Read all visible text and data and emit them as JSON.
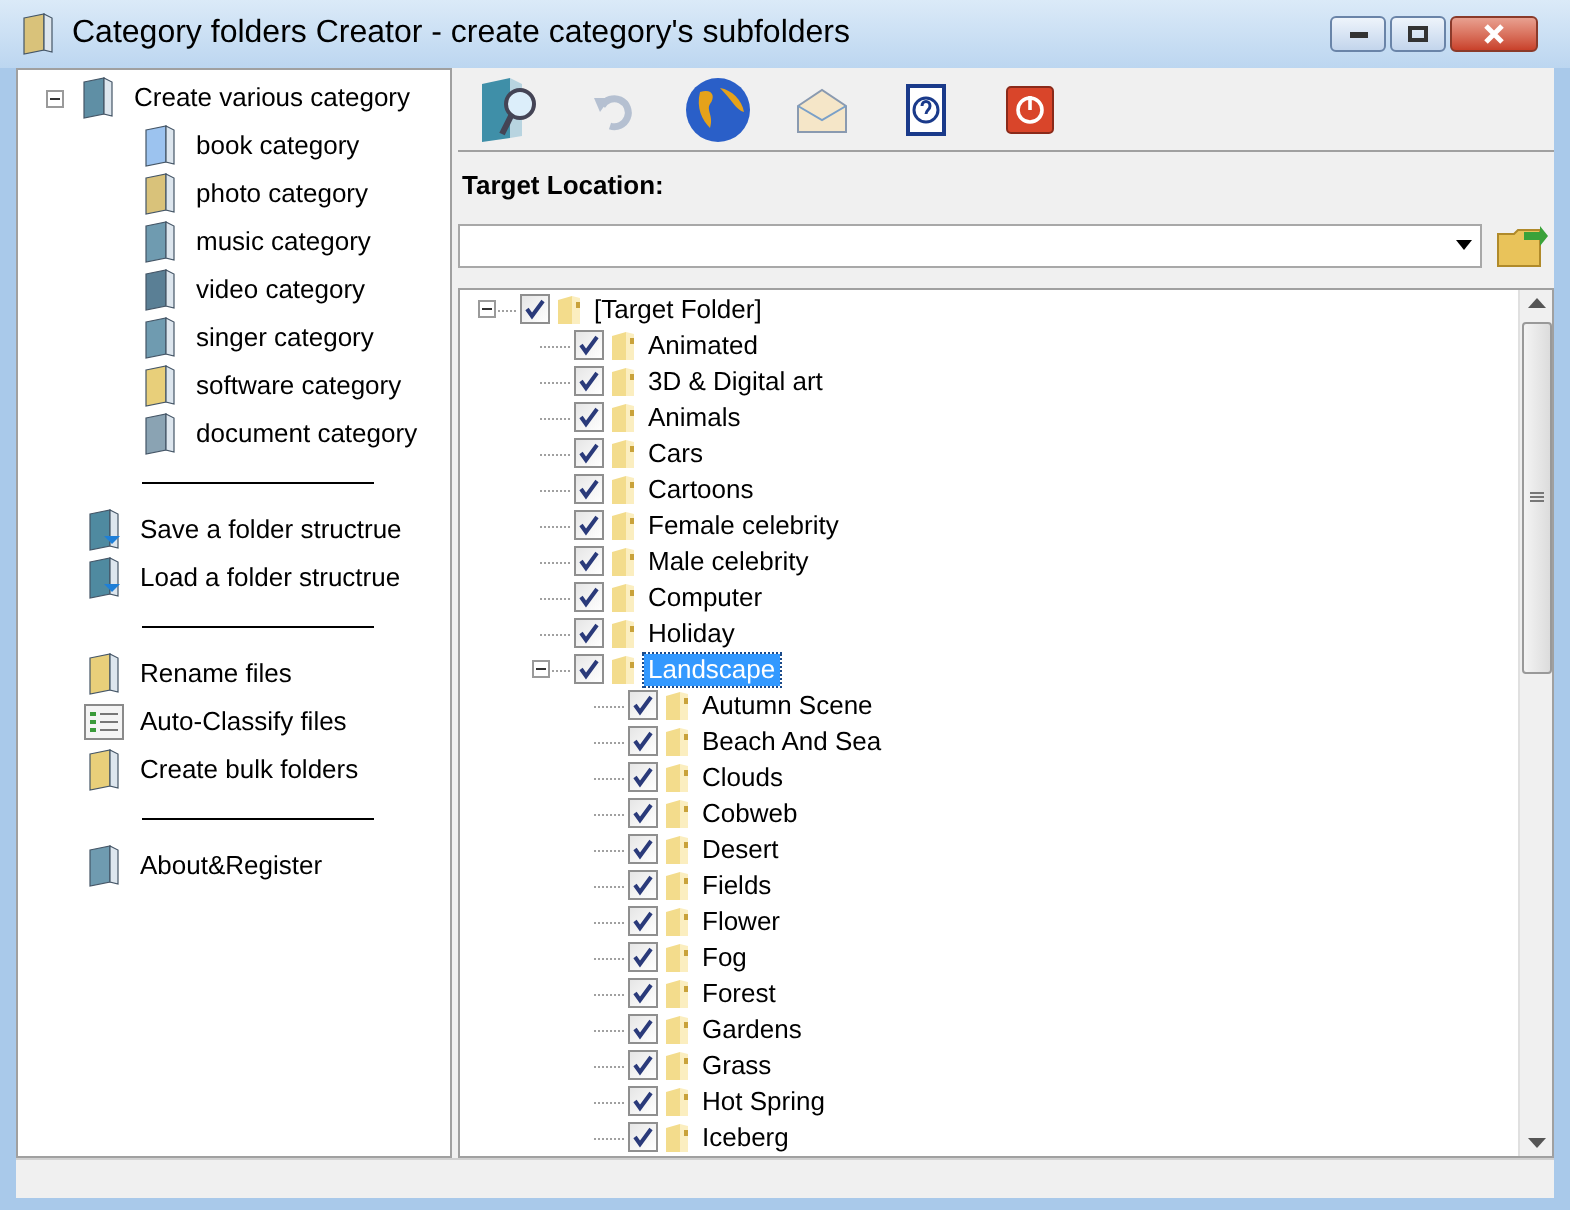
{
  "window": {
    "title": "Category folders Creator -  create category's subfolders"
  },
  "sidebar": {
    "items": [
      {
        "kind": "node",
        "label": "Create various category",
        "expanded": true,
        "children": [
          {
            "kind": "book",
            "label": "book category"
          },
          {
            "kind": "photo",
            "label": "photo category"
          },
          {
            "kind": "music",
            "label": "music category"
          },
          {
            "kind": "video",
            "label": "video category"
          },
          {
            "kind": "singer",
            "label": "singer category"
          },
          {
            "kind": "folder",
            "label": "software category"
          },
          {
            "kind": "document",
            "label": "document category"
          }
        ]
      },
      {
        "kind": "separator"
      },
      {
        "kind": "save",
        "label": "Save a folder structrue"
      },
      {
        "kind": "load",
        "label": "Load a folder structrue"
      },
      {
        "kind": "separator"
      },
      {
        "kind": "folder",
        "label": "Rename files"
      },
      {
        "kind": "list",
        "label": "Auto-Classify files"
      },
      {
        "kind": "folder",
        "label": "Create bulk folders"
      },
      {
        "kind": "separator"
      },
      {
        "kind": "about",
        "label": "About&Register"
      }
    ]
  },
  "toolbar": [
    {
      "kind": "browse",
      "disabled": false
    },
    {
      "kind": "undo",
      "disabled": true
    },
    {
      "kind": "web",
      "disabled": false
    },
    {
      "kind": "mail",
      "disabled": false
    },
    {
      "kind": "help",
      "disabled": false
    },
    {
      "kind": "exit",
      "disabled": false
    }
  ],
  "target_location": {
    "label": "Target Location:"
  },
  "tree": {
    "root": {
      "label": "[Target Folder]",
      "checked": true,
      "expanded": true,
      "selected": false,
      "children": [
        {
          "label": "Animated",
          "checked": true,
          "selected": false
        },
        {
          "label": "3D & Digital art",
          "checked": true,
          "selected": false
        },
        {
          "label": "Animals",
          "checked": true,
          "selected": false
        },
        {
          "label": "Cars",
          "checked": true,
          "selected": false
        },
        {
          "label": "Cartoons",
          "checked": true,
          "selected": false
        },
        {
          "label": "Female celebrity",
          "checked": true,
          "selected": false
        },
        {
          "label": "Male celebrity",
          "checked": true,
          "selected": false
        },
        {
          "label": "Computer",
          "checked": true,
          "selected": false
        },
        {
          "label": "Holiday",
          "checked": true,
          "selected": false
        },
        {
          "label": "Landscape",
          "checked": true,
          "selected": true,
          "expanded": true,
          "children": [
            {
              "label": "Autumn Scene",
              "checked": true,
              "selected": false
            },
            {
              "label": "Beach And Sea",
              "checked": true,
              "selected": false
            },
            {
              "label": "Clouds",
              "checked": true,
              "selected": false
            },
            {
              "label": "Cobweb",
              "checked": true,
              "selected": false
            },
            {
              "label": "Desert",
              "checked": true,
              "selected": false
            },
            {
              "label": "Fields",
              "checked": true,
              "selected": false
            },
            {
              "label": "Flower",
              "checked": true,
              "selected": false
            },
            {
              "label": "Fog",
              "checked": true,
              "selected": false
            },
            {
              "label": "Forest",
              "checked": true,
              "selected": false
            },
            {
              "label": "Gardens",
              "checked": true,
              "selected": false
            },
            {
              "label": "Grass",
              "checked": true,
              "selected": false
            },
            {
              "label": "Hot Spring",
              "checked": true,
              "selected": false
            },
            {
              "label": "Iceberg",
              "checked": true,
              "selected": false
            }
          ]
        }
      ]
    }
  }
}
